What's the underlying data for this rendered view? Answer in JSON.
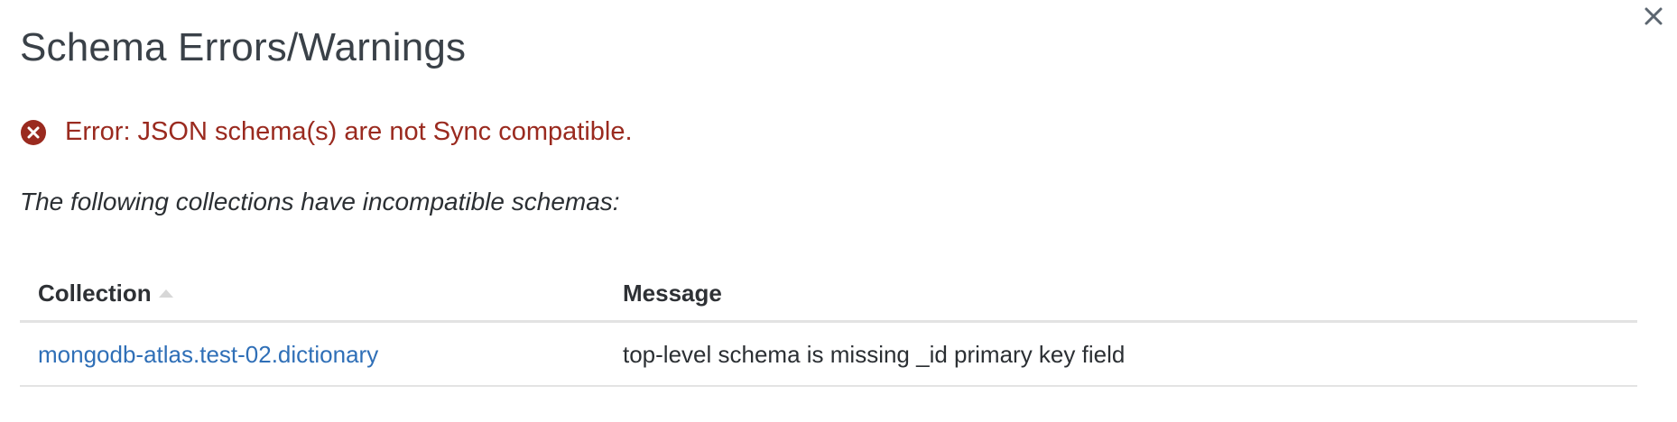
{
  "modal": {
    "title": "Schema Errors/Warnings",
    "close_icon": "close-icon"
  },
  "error": {
    "icon": "error-circle-x-icon",
    "text": "Error: JSON schema(s) are not Sync compatible.",
    "color": "#9a2a1f"
  },
  "subtitle": "The following collections have incompatible schemas:",
  "table": {
    "columns": [
      {
        "label": "Collection",
        "sort_icon": "sort-ascending-icon"
      },
      {
        "label": "Message"
      }
    ],
    "rows": [
      {
        "collection": "mongodb-atlas.test-02.dictionary",
        "message": "top-level schema is missing _id primary key field"
      }
    ]
  },
  "colors": {
    "link": "#2f6fb7",
    "title": "#3a4148",
    "divider": "#e3e3e3"
  }
}
